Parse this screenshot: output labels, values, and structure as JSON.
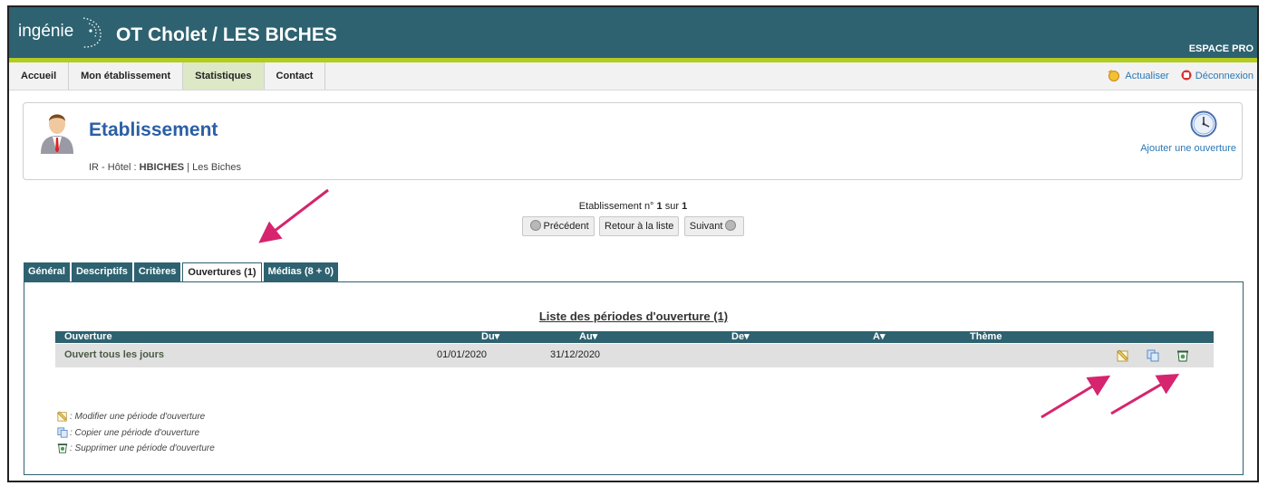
{
  "header": {
    "logo": "ingénie",
    "title": "OT Cholet / LES BICHES",
    "espace": "ESPACE PRO"
  },
  "nav": {
    "items": [
      {
        "label": "Accueil"
      },
      {
        "label": "Mon établissement"
      },
      {
        "label": "Statistiques"
      },
      {
        "label": "Contact"
      }
    ],
    "active_index": 2,
    "refresh": "Actualiser",
    "logout": "Déconnexion"
  },
  "etablissement": {
    "title": "Etablissement",
    "sub_prefix": "IR - Hôtel :",
    "code": "HBICHES",
    "sep": "|",
    "name": "Les Biches",
    "add_opening": "Ajouter une ouverture"
  },
  "pager": {
    "prefix": "Etablissement n°",
    "current": "1",
    "middle": "sur",
    "total": "1",
    "prev": "Précédent",
    "back": "Retour à la liste",
    "next": "Suivant"
  },
  "tabs": [
    {
      "label": "Général"
    },
    {
      "label": "Descriptifs"
    },
    {
      "label": "Critères"
    },
    {
      "label": "Ouvertures (1)"
    },
    {
      "label": "Médias (8 + 0)"
    }
  ],
  "active_tab": 3,
  "list": {
    "title": "Liste des périodes d'ouverture (1)",
    "columns": [
      "Ouverture",
      "Du",
      "Au",
      "De",
      "A",
      "Thème"
    ],
    "sort_marker": "▾",
    "rows": [
      {
        "ouverture": "Ouvert tous les jours",
        "du": "01/01/2020",
        "au": "31/12/2020",
        "de": "",
        "a": "",
        "theme": ""
      }
    ]
  },
  "legend": {
    "edit": ": Modifier une période d'ouverture",
    "copy": ": Copier une période d'ouverture",
    "delete": ": Supprimer une période d'ouverture"
  },
  "colors": {
    "header": "#2e6270",
    "green_bar": "#b4cc1e",
    "link": "#2a78b4",
    "title_blue": "#2a5fa6",
    "arrow": "#d6246e"
  }
}
